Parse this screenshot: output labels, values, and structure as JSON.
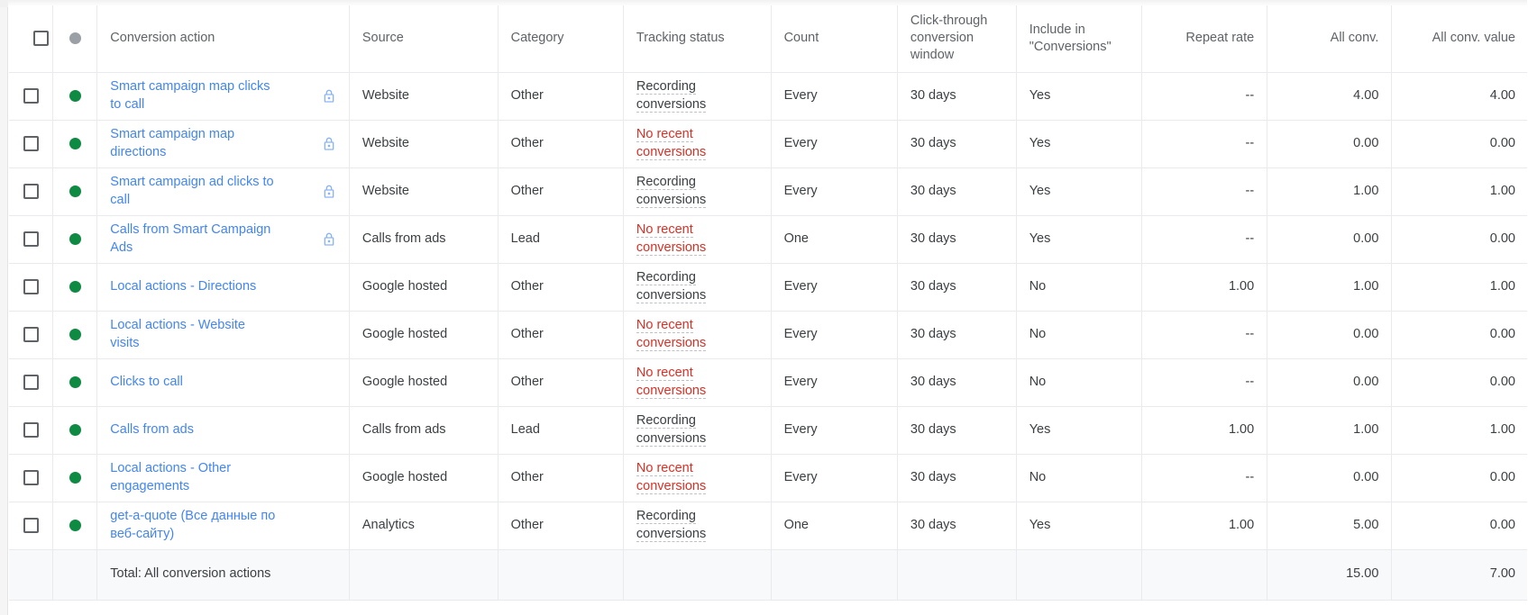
{
  "table": {
    "columns": [
      {
        "key": "select",
        "label": "",
        "align": "center"
      },
      {
        "key": "status",
        "label": "",
        "align": "center"
      },
      {
        "key": "action",
        "label": "Conversion action",
        "align": "left"
      },
      {
        "key": "source",
        "label": "Source",
        "align": "left"
      },
      {
        "key": "category",
        "label": "Category",
        "align": "left"
      },
      {
        "key": "tracking",
        "label": "Tracking status",
        "align": "left"
      },
      {
        "key": "count",
        "label": "Count",
        "align": "left"
      },
      {
        "key": "window",
        "label": "Click-through conversion window",
        "align": "left"
      },
      {
        "key": "include",
        "label": "Include in \"Conversions\"",
        "align": "left"
      },
      {
        "key": "repeat",
        "label": "Repeat rate",
        "align": "right"
      },
      {
        "key": "allconv",
        "label": "All conv.",
        "align": "right"
      },
      {
        "key": "allvalue",
        "label": "All conv. value",
        "align": "right"
      }
    ],
    "header": {
      "select_all_checkbox": "unchecked",
      "status_header_icon": "status-dot-icon"
    },
    "rows": [
      {
        "status": "green",
        "action": "Smart campaign map clicks to call",
        "locked": true,
        "source": "Website",
        "category": "Other",
        "tracking": "Recording conversions",
        "tracking_state": "ok",
        "count": "Every",
        "window": "30 days",
        "include": "Yes",
        "repeat": "--",
        "allconv": "4.00",
        "allvalue": "4.00"
      },
      {
        "status": "green",
        "action": "Smart campaign map directions",
        "locked": true,
        "source": "Website",
        "category": "Other",
        "tracking": "No recent conversions",
        "tracking_state": "bad",
        "count": "Every",
        "window": "30 days",
        "include": "Yes",
        "repeat": "--",
        "allconv": "0.00",
        "allvalue": "0.00"
      },
      {
        "status": "green",
        "action": "Smart campaign ad clicks to call",
        "locked": true,
        "source": "Website",
        "category": "Other",
        "tracking": "Recording conversions",
        "tracking_state": "ok",
        "count": "Every",
        "window": "30 days",
        "include": "Yes",
        "repeat": "--",
        "allconv": "1.00",
        "allvalue": "1.00"
      },
      {
        "status": "green",
        "action": "Calls from Smart Campaign Ads",
        "locked": true,
        "source": "Calls from ads",
        "category": "Lead",
        "tracking": "No recent conversions",
        "tracking_state": "bad",
        "count": "One",
        "window": "30 days",
        "include": "Yes",
        "repeat": "--",
        "allconv": "0.00",
        "allvalue": "0.00"
      },
      {
        "status": "green",
        "action": "Local actions - Directions",
        "locked": false,
        "source": "Google hosted",
        "category": "Other",
        "tracking": "Recording conversions",
        "tracking_state": "ok",
        "count": "Every",
        "window": "30 days",
        "include": "No",
        "repeat": "1.00",
        "allconv": "1.00",
        "allvalue": "1.00"
      },
      {
        "status": "green",
        "action": "Local actions - Website visits",
        "locked": false,
        "source": "Google hosted",
        "category": "Other",
        "tracking": "No recent conversions",
        "tracking_state": "bad",
        "count": "Every",
        "window": "30 days",
        "include": "No",
        "repeat": "--",
        "allconv": "0.00",
        "allvalue": "0.00"
      },
      {
        "status": "green",
        "action": "Clicks to call",
        "locked": false,
        "source": "Google hosted",
        "category": "Other",
        "tracking": "No recent conversions",
        "tracking_state": "bad",
        "count": "Every",
        "window": "30 days",
        "include": "No",
        "repeat": "--",
        "allconv": "0.00",
        "allvalue": "0.00"
      },
      {
        "status": "green",
        "action": "Calls from ads",
        "locked": false,
        "source": "Calls from ads",
        "category": "Lead",
        "tracking": "Recording conversions",
        "tracking_state": "ok",
        "count": "Every",
        "window": "30 days",
        "include": "Yes",
        "repeat": "1.00",
        "allconv": "1.00",
        "allvalue": "1.00"
      },
      {
        "status": "green",
        "action": "Local actions - Other engagements",
        "locked": false,
        "source": "Google hosted",
        "category": "Other",
        "tracking": "No recent conversions",
        "tracking_state": "bad",
        "count": "Every",
        "window": "30 days",
        "include": "No",
        "repeat": "--",
        "allconv": "0.00",
        "allvalue": "0.00"
      },
      {
        "status": "green",
        "action": "get-a-quote (Все данные по веб-сайту)",
        "locked": false,
        "source": "Analytics",
        "category": "Other",
        "tracking": "Recording conversions",
        "tracking_state": "ok",
        "count": "One",
        "window": "30 days",
        "include": "Yes",
        "repeat": "1.00",
        "allconv": "5.00",
        "allvalue": "0.00"
      }
    ],
    "total_row": {
      "label": "Total: All conversion actions",
      "source": "",
      "category": "",
      "tracking": "",
      "count": "",
      "window": "",
      "include": "",
      "repeat": "",
      "allconv": "15.00",
      "allvalue": "7.00"
    }
  },
  "colors": {
    "link": "#4285f4",
    "status_ok": "#3c4043",
    "status_error": "#d93025",
    "dot_active": "#0f8a43",
    "dot_header": "#9aa0a6",
    "lock": "#8ab4f8",
    "header_text": "#5f6368",
    "header_rule": "#80868b",
    "row_border": "#e8eaed",
    "total_bg": "#f8f9fa"
  }
}
